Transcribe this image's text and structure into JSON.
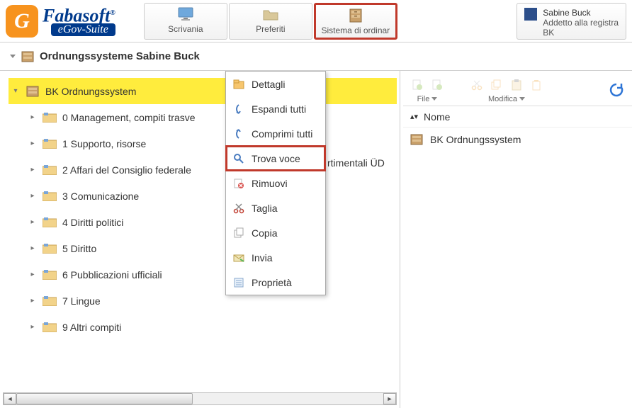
{
  "header": {
    "brand": "Fabasoft",
    "suite": "eGov-Suite",
    "nav": [
      {
        "label": "Scrivania",
        "icon": "monitor-icon"
      },
      {
        "label": "Preferiti",
        "icon": "folder-icon"
      },
      {
        "label": "Sistema di ordinar",
        "icon": "cabinet-icon",
        "highlighted": true
      }
    ],
    "user": {
      "name": "Sabine Buck",
      "role": "Addetto alla registra",
      "org": "BK"
    }
  },
  "breadcrumb": {
    "title": "Ordnungssysteme Sabine Buck"
  },
  "tree": {
    "root": {
      "label": "BK Ordnungssystem",
      "selected": true
    },
    "children": [
      {
        "label": "0 Management, compiti trasve"
      },
      {
        "label": "1 Supporto, risorse"
      },
      {
        "label": "2 Affari del Consiglio federale"
      },
      {
        "label": "3 Comunicazione"
      },
      {
        "label": "4 Diritti politici"
      },
      {
        "label": "5 Diritto"
      },
      {
        "label": "6 Pubblicazioni ufficiali"
      },
      {
        "label": "7 Lingue"
      },
      {
        "label": "9 Altri compiti"
      }
    ],
    "partial_text": "rtimentali ÜD"
  },
  "context_menu": {
    "items": [
      {
        "label": "Dettagli",
        "icon": "details-icon"
      },
      {
        "label": "Espandi tutti",
        "icon": "expand-icon"
      },
      {
        "label": "Comprimi tutti",
        "icon": "collapse-icon"
      },
      {
        "label": "Trova voce",
        "icon": "search-icon",
        "highlighted": true
      },
      {
        "label": "Rimuovi",
        "icon": "remove-icon"
      },
      {
        "label": "Taglia",
        "icon": "cut-icon"
      },
      {
        "label": "Copia",
        "icon": "copy-icon"
      },
      {
        "label": "Invia",
        "icon": "send-icon"
      },
      {
        "label": "Proprietà",
        "icon": "properties-icon"
      }
    ]
  },
  "right_panel": {
    "toolbar": {
      "file_label": "File",
      "edit_label": "Modifica"
    },
    "column_header": "Nome",
    "rows": [
      {
        "label": "BK Ordnungssystem"
      }
    ]
  },
  "colors": {
    "accent_orange": "#f7931e",
    "brand_blue": "#003a8c",
    "highlight_red": "#c0392b",
    "selection_yellow": "#ffec3d"
  }
}
